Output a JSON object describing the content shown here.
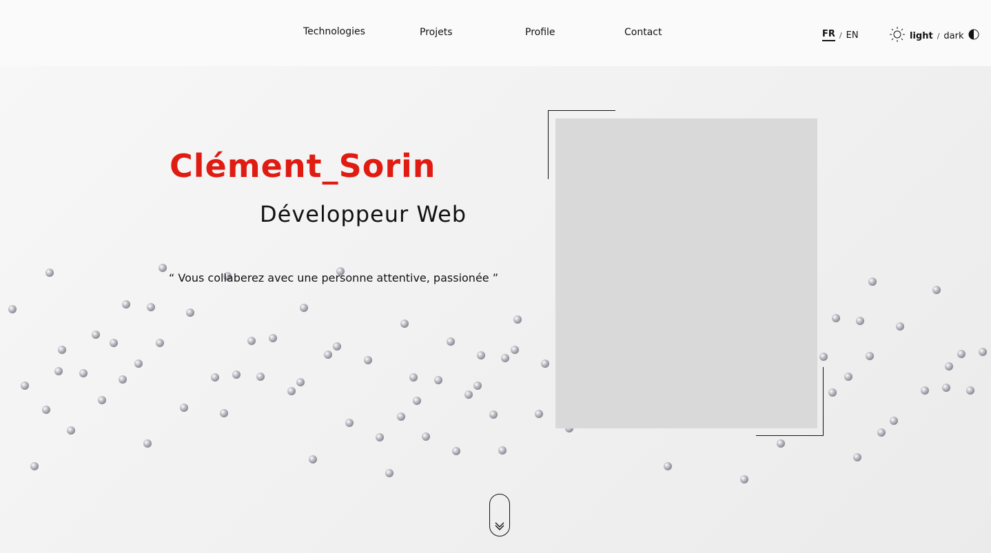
{
  "nav": {
    "items": [
      "Technologies",
      "Projets",
      "Profile",
      "Contact"
    ]
  },
  "lang": {
    "active": "FR",
    "separator": "/",
    "other": "EN"
  },
  "theme": {
    "light": "light",
    "separator": "/",
    "dark": "dark",
    "sun_icon": "sun-icon",
    "contrast_icon": "half-circle-icon"
  },
  "hero": {
    "name": "Clément_Sorin",
    "role": "Développeur Web",
    "quote": "“ Vous collaberez avec une personne attentive, passionée ”"
  },
  "colors": {
    "accent": "#e01b12",
    "photo_placeholder": "#d9d9d9"
  },
  "scroll_icon": "double-chevron-down-icon"
}
